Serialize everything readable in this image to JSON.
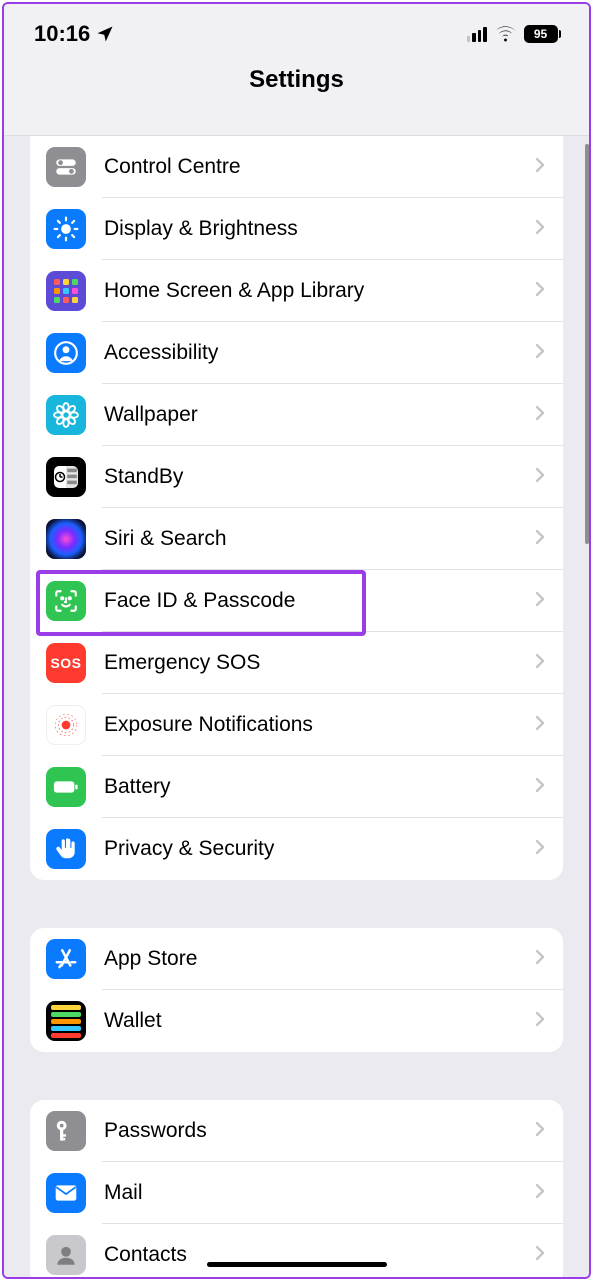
{
  "status_bar": {
    "time": "10:16",
    "battery_pct": "95"
  },
  "header": {
    "title": "Settings"
  },
  "groups": [
    {
      "id": "general",
      "first_cut": true,
      "items": [
        {
          "id": "control-centre",
          "label": "Control Centre",
          "icon": "toggles",
          "bg": "#8e8e93"
        },
        {
          "id": "display",
          "label": "Display & Brightness",
          "icon": "sun",
          "bg": "#0a7aff"
        },
        {
          "id": "home-screen",
          "label": "Home Screen & App Library",
          "icon": "grid",
          "bg": "#5b4bd6"
        },
        {
          "id": "accessibility",
          "label": "Accessibility",
          "icon": "person-circle",
          "bg": "#0a7aff"
        },
        {
          "id": "wallpaper",
          "label": "Wallpaper",
          "icon": "flower",
          "bg": "#18b5dc"
        },
        {
          "id": "standby",
          "label": "StandBy",
          "icon": "standby",
          "bg": "#000000"
        },
        {
          "id": "siri",
          "label": "Siri & Search",
          "icon": "siri",
          "bg": "#000000"
        },
        {
          "id": "faceid",
          "label": "Face ID & Passcode",
          "icon": "faceid",
          "bg": "#30c452",
          "highlighted": true
        },
        {
          "id": "sos",
          "label": "Emergency SOS",
          "icon": "sos",
          "bg": "#ff3b30"
        },
        {
          "id": "exposure",
          "label": "Exposure Notifications",
          "icon": "exposure",
          "bg": "#ffffff"
        },
        {
          "id": "battery",
          "label": "Battery",
          "icon": "battery",
          "bg": "#30c452"
        },
        {
          "id": "privacy",
          "label": "Privacy & Security",
          "icon": "hand",
          "bg": "#0a7aff"
        }
      ]
    },
    {
      "id": "store",
      "items": [
        {
          "id": "appstore",
          "label": "App Store",
          "icon": "appstore",
          "bg": "#0a7aff"
        },
        {
          "id": "wallet",
          "label": "Wallet",
          "icon": "wallet",
          "bg": "#000000"
        }
      ]
    },
    {
      "id": "accounts",
      "items": [
        {
          "id": "passwords",
          "label": "Passwords",
          "icon": "key",
          "bg": "#8e8e93"
        },
        {
          "id": "mail",
          "label": "Mail",
          "icon": "mail",
          "bg": "#0a7aff"
        },
        {
          "id": "contacts",
          "label": "Contacts",
          "icon": "contacts",
          "bg": "#c9c9cd"
        }
      ]
    }
  ],
  "sos_text": "SOS"
}
